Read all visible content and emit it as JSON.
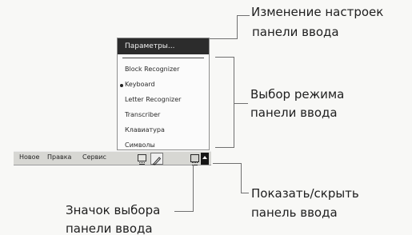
{
  "menu": {
    "header": "Параметры...",
    "items": [
      "Block Recognizer",
      "Keyboard",
      "Letter Recognizer",
      "Transcriber",
      "Клавиатура",
      "Символы"
    ]
  },
  "bar": {
    "items": [
      "Новое",
      "Правка",
      "Сервис"
    ]
  },
  "labels": {
    "settings": [
      "Изменение настроек",
      "панели ввода"
    ],
    "mode": [
      "Выбор режима",
      "панели ввода"
    ],
    "show_hide": [
      "Показать/скрыть",
      "панель ввода"
    ],
    "icon": [
      "Значок выбора",
      "панели ввода"
    ]
  }
}
